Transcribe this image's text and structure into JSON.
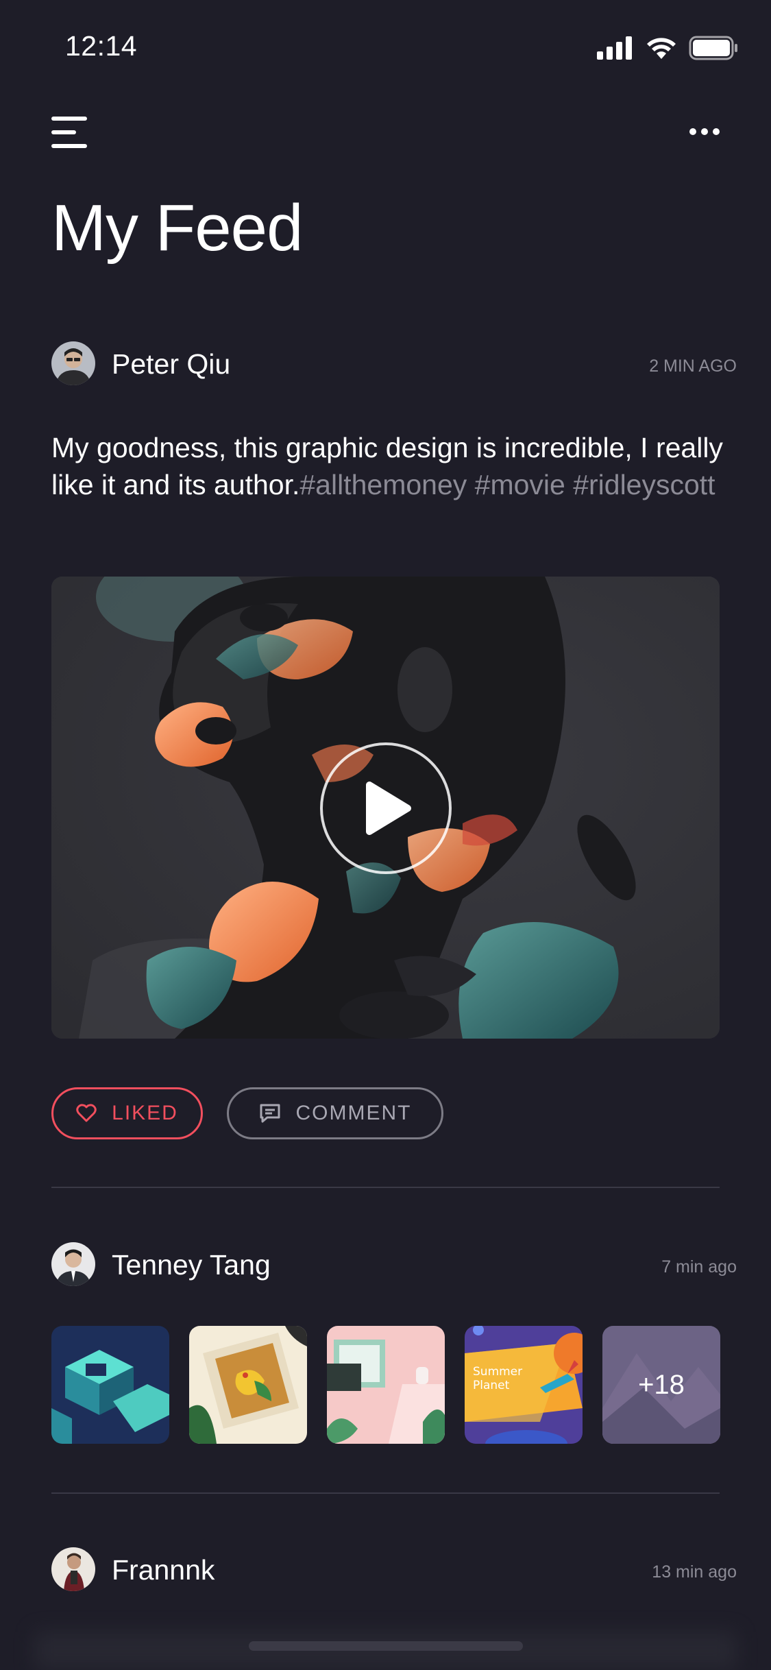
{
  "status_bar": {
    "time": "12:14"
  },
  "header": {
    "title": "My Feed",
    "menu_icon": "hamburger-menu-icon",
    "more_icon": "ellipsis-icon"
  },
  "posts": [
    {
      "author": "Peter Qiu",
      "time": "2 MIN AGO",
      "text": "My goodness, this graphic design is incredible, I really like it and its author.",
      "tags": "#allthemoney #movie #ridleyscott",
      "media_type": "video",
      "actions": {
        "liked_label": "LIKED",
        "comment_label": "COMMENT"
      }
    },
    {
      "author": "Tenney Tang",
      "time": "7 min ago",
      "media_type": "gallery",
      "more_count": "+18",
      "thumb_captions": [
        "Summer",
        "Planet"
      ]
    },
    {
      "author": "Frannnk",
      "time": "13 min ago"
    }
  ],
  "colors": {
    "background": "#1e1d28",
    "accent_liked": "#f24f5e",
    "muted_text": "#8c8b96"
  }
}
